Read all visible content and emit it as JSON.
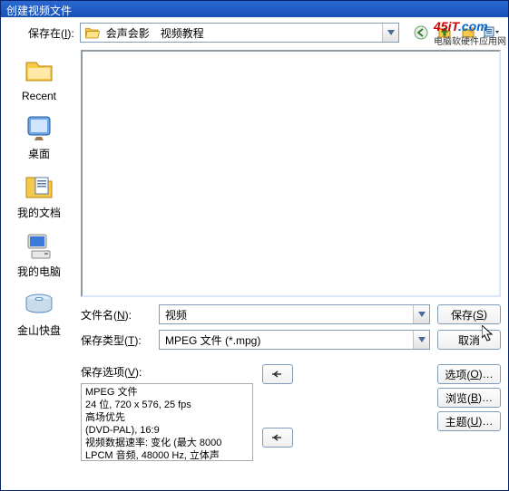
{
  "title": "创建视频文件",
  "watermark": {
    "logo_main": "45iT",
    "logo_suffix": ".com",
    "sub": "电脑软硬件应用网"
  },
  "toprow": {
    "label_pre": "保存在(",
    "label_u": "I",
    "label_post": "):",
    "folder_name": "会声会影　视频教程"
  },
  "sidebar": {
    "recent": "Recent",
    "desktop": "桌面",
    "mydocs": "我的文档",
    "mycomp": "我的电脑",
    "kuaipan": "金山快盘"
  },
  "filename": {
    "label_pre": "文件名(",
    "label_u": "N",
    "label_post": "):",
    "value": "视频"
  },
  "filetype": {
    "label_pre": "保存类型(",
    "label_u": "T",
    "label_post": "):",
    "value": "MPEG 文件 (*.mpg)"
  },
  "buttons": {
    "save_pre": "保存(",
    "save_u": "S",
    "save_post": ")",
    "cancel": "取消",
    "options_pre": "选项(",
    "options_u": "O",
    "options_post": ")…",
    "browse_pre": "浏览(",
    "browse_u": "B",
    "browse_post": ")…",
    "theme_pre": "主题(",
    "theme_u": "U",
    "theme_post": ")…"
  },
  "saveopt": {
    "label_pre": "保存选项(",
    "label_u": "V",
    "label_post": "):"
  },
  "info": {
    "l1": "MPEG 文件",
    "l2": "24 位, 720 x 576, 25 fps",
    "l3": "高场优先",
    "l4": "(DVD-PAL),  16:9",
    "l5": "视频数据速率: 变化 (最大  8000",
    "l6": "LPCM 音频, 48000 Hz, 立体声"
  }
}
